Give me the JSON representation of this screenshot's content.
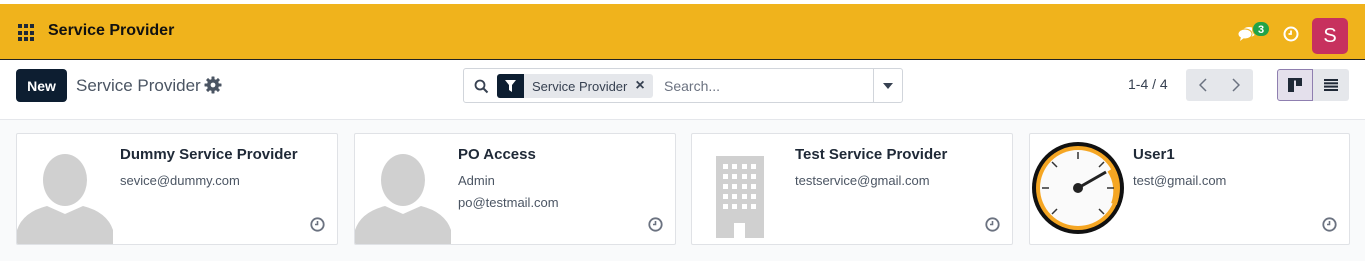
{
  "app": {
    "title": "Service Provider"
  },
  "topbar": {
    "chat_count": "3",
    "avatar_letter": "S",
    "avatar_color": "#c7315e",
    "bar_color": "#f0b31c"
  },
  "control": {
    "new_label": "New",
    "breadcrumb": "Service Provider",
    "facet_label": "Service Provider",
    "search_placeholder": "Search...",
    "pager": "1-4 / 4"
  },
  "cards": [
    {
      "name": "Dummy Service Provider",
      "line1": "sevice@dummy.com",
      "line2": "",
      "image": "person-placeholder"
    },
    {
      "name": "PO Access",
      "line1": "Admin",
      "line2": "po@testmail.com",
      "image": "person-placeholder"
    },
    {
      "name": "Test Service Provider",
      "line1": "testservice@gmail.com",
      "line2": "",
      "image": "building-placeholder"
    },
    {
      "name": "User1",
      "line1": "test@gmail.com",
      "line2": "",
      "image": "speedometer"
    }
  ]
}
